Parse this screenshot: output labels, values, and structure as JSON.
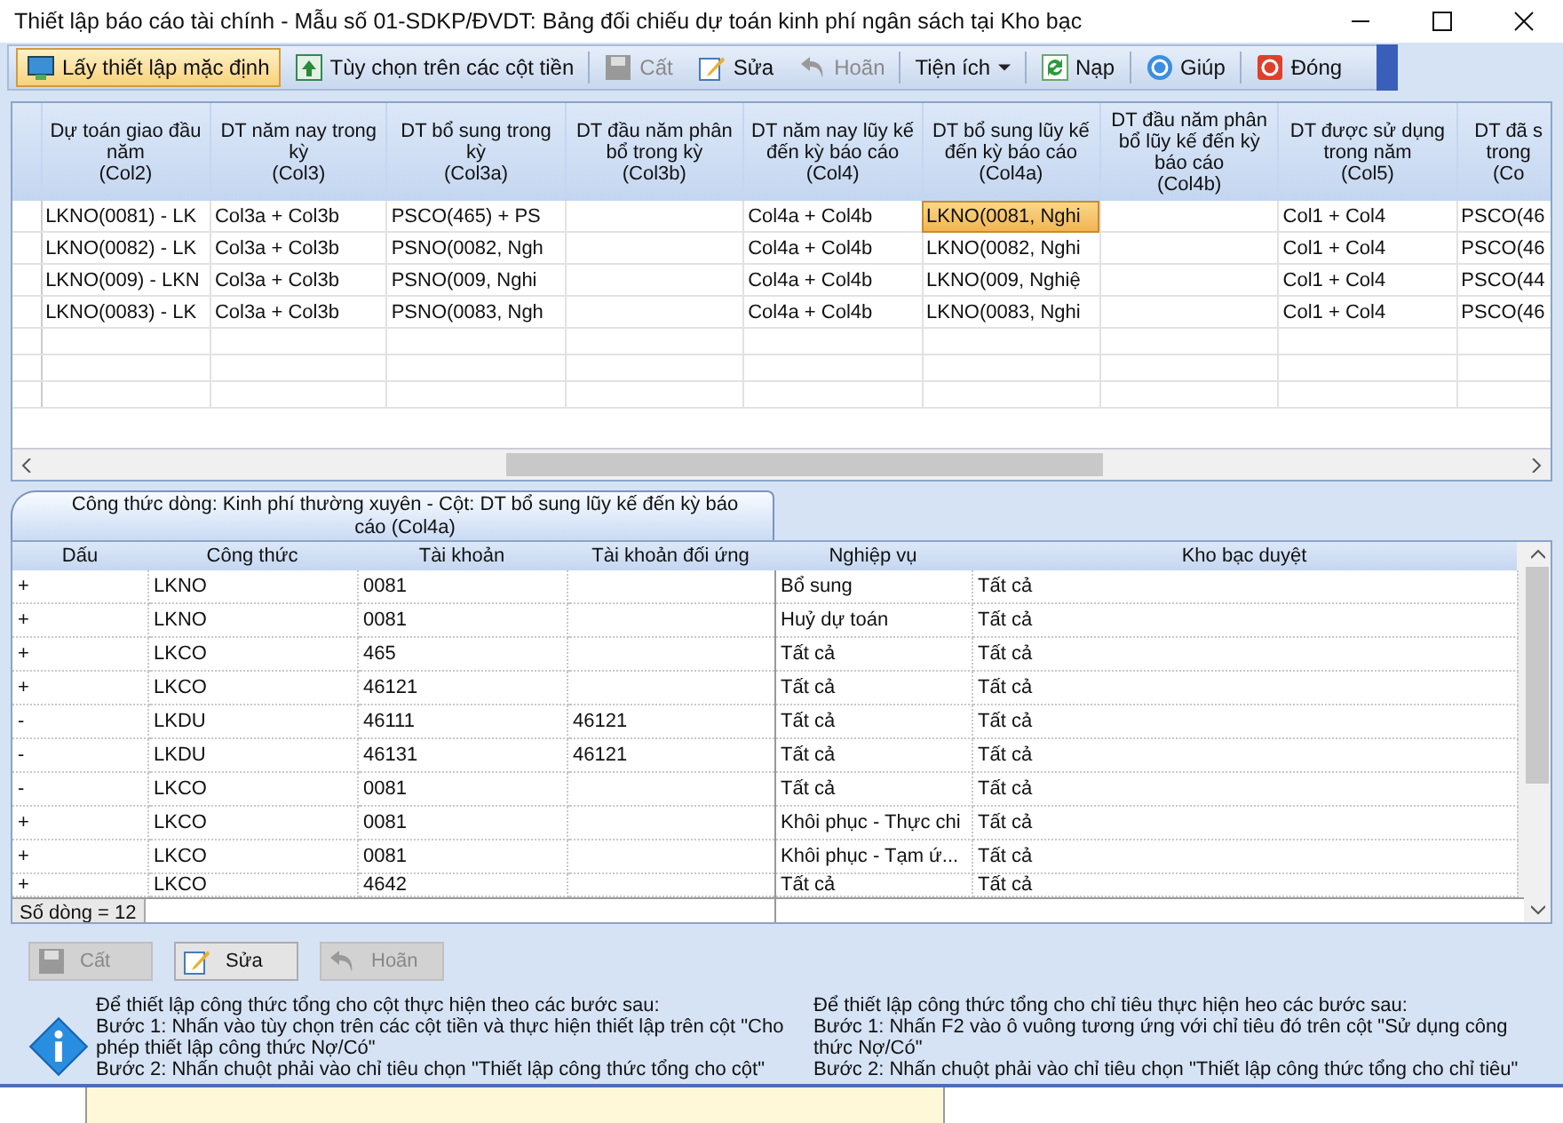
{
  "window": {
    "title": "Thiết lập báo cáo tài chính - Mẫu số 01-SDKP/ĐVDT: Bảng đối chiếu dự toán kinh phí ngân sách tại Kho bạc"
  },
  "toolbar": [
    {
      "kind": "default",
      "label": "Lấy thiết lập mặc định",
      "disabled": false
    },
    {
      "kind": "options",
      "label": "Tùy chọn trên các cột tiền",
      "disabled": false
    },
    {
      "kind": "save",
      "label": "Cất",
      "disabled": true
    },
    {
      "kind": "edit",
      "label": "Sửa",
      "disabled": false
    },
    {
      "kind": "undo",
      "label": "Hoãn",
      "disabled": true
    },
    {
      "kind": "menu",
      "label": "Tiện ích",
      "disabled": false
    },
    {
      "kind": "reload",
      "label": "Nạp",
      "disabled": false
    },
    {
      "kind": "help",
      "label": "Giúp",
      "disabled": false
    },
    {
      "kind": "close",
      "label": "Đóng",
      "disabled": false
    }
  ],
  "top_table": {
    "columns": [
      "Dự toán giao đầu\nnăm\n(Col2)",
      "DT năm nay trong\nkỳ\n(Col3)",
      "DT bổ sung trong\nkỳ\n(Col3a)",
      "DT đầu năm phân\nbổ trong kỳ\n(Col3b)",
      "DT năm nay lũy kế\nđến kỳ báo cáo\n(Col4)",
      "DT bổ sung lũy kế\nđến kỳ báo cáo\n(Col4a)",
      "DT đầu năm phân\nbổ lũy kế đến kỳ\nbáo cáo\n(Col4b)",
      "DT được sử dụng\ntrong năm\n(Col5)",
      "DT đã s\ntrong\n(Co"
    ],
    "rows": [
      {
        "cells": [
          {
            "text": "LKNO(0081) - LK",
            "selected": false
          },
          {
            "text": "Col3a + Col3b",
            "selected": false
          },
          {
            "text": "PSCO(465) + PS",
            "selected": false
          },
          {
            "selected": false
          },
          {
            "text": "Col4a + Col4b",
            "selected": false
          },
          {
            "text": "LKNO(0081, Nghi",
            "selected": true
          },
          {
            "selected": false
          },
          {
            "text": "Col1 + Col4",
            "selected": false
          },
          {
            "text": "PSCO(46",
            "selected": false
          }
        ]
      },
      {
        "cells": [
          {
            "text": "LKNO(0082) - LK",
            "selected": false
          },
          {
            "text": "Col3a + Col3b",
            "selected": false
          },
          {
            "text": "PSNO(0082, Ngh",
            "selected": false
          },
          {
            "selected": false
          },
          {
            "text": "Col4a + Col4b",
            "selected": false
          },
          {
            "text": "LKNO(0082, Nghi",
            "selected": false
          },
          {
            "selected": false
          },
          {
            "text": "Col1 + Col4",
            "selected": false
          },
          {
            "text": "PSCO(46",
            "selected": false
          }
        ]
      },
      {
        "cells": [
          {
            "text": "LKNO(009) - LKN",
            "selected": false
          },
          {
            "text": "Col3a + Col3b",
            "selected": false
          },
          {
            "text": "PSNO(009, Nghi",
            "selected": false
          },
          {
            "selected": false
          },
          {
            "text": "Col4a + Col4b",
            "selected": false
          },
          {
            "text": "LKNO(009, Nghiệ",
            "selected": false
          },
          {
            "selected": false
          },
          {
            "text": "Col1 + Col4",
            "selected": false
          },
          {
            "text": "PSCO(44",
            "selected": false
          }
        ]
      },
      {
        "cells": [
          {
            "text": "LKNO(0083) - LK",
            "selected": false
          },
          {
            "text": "Col3a + Col3b",
            "selected": false
          },
          {
            "text": "PSNO(0083, Ngh",
            "selected": false
          },
          {
            "selected": false
          },
          {
            "text": "Col4a + Col4b",
            "selected": false
          },
          {
            "text": "LKNO(0083, Nghi",
            "selected": false
          },
          {
            "selected": false
          },
          {
            "text": "Col1 + Col4",
            "selected": false
          },
          {
            "text": "PSCO(46",
            "selected": false
          }
        ]
      }
    ]
  },
  "tab": {
    "label": "Công thức dòng: Kinh phí thường xuyên - Cột: DT bổ sung lũy kế đến kỳ báo cáo (Col4a)",
    "selected": true
  },
  "formula_table": {
    "columns": [
      "Dấu",
      "Công thức",
      "Tài khoản",
      "Tài khoản đối ứng",
      "Nghiệp vụ",
      "Kho bạc duyệt"
    ],
    "rows": [
      [
        "+",
        "LKNO",
        "0081",
        "",
        "Bổ sung",
        "Tất cả"
      ],
      [
        "+",
        "LKNO",
        "0081",
        "",
        "Huỷ dự toán",
        "Tất cả"
      ],
      [
        "+",
        "LKCO",
        "465",
        "",
        "Tất cả",
        "Tất cả"
      ],
      [
        "+",
        "LKCO",
        "46121",
        "",
        "Tất cả",
        "Tất cả"
      ],
      [
        "-",
        "LKDU",
        "46111",
        "46121",
        "Tất cả",
        "Tất cả"
      ],
      [
        "-",
        "LKDU",
        "46131",
        "46121",
        "Tất cả",
        "Tất cả"
      ],
      [
        "-",
        "LKCO",
        "0081",
        "",
        "Tất cả",
        "Tất cả"
      ],
      [
        "+",
        "LKCO",
        "0081",
        "",
        "Khôi phục - Thực chi",
        "Tất cả"
      ],
      [
        "+",
        "LKCO",
        "0081",
        "",
        "Khôi phục - Tạm ứ...",
        "Tất cả"
      ],
      [
        "+",
        "LKCO",
        "4642",
        "",
        "Tất cả",
        "Tất cả"
      ]
    ],
    "footer": "Số dòng = 12"
  },
  "actions": [
    {
      "kind": "save",
      "label": "Cất",
      "disabled": true
    },
    {
      "kind": "edit",
      "label": "Sửa",
      "disabled": false
    },
    {
      "kind": "undo",
      "label": "Hoãn",
      "disabled": true
    }
  ],
  "help": [
    [
      "Để thiết lập công thức tổng cho cột thực hiện theo các bước sau:",
      "Bước 1: Nhấn vào tùy chọn trên các cột tiền và thực hiện thiết lập trên cột \"Cho phép thiết lập công thức Nợ/Có\"",
      "Bước 2: Nhấn chuột phải vào chỉ tiêu chọn \"Thiết lập công thức tổng cho cột\""
    ],
    [
      "Để thiết lập công thức tổng cho chỉ tiêu thực hiện heo các bước sau:",
      "Bước 1: Nhấn F2 vào ô vuông tương ứng với chỉ tiêu đó trên cột  \"Sử dụng công thức Nợ/Có\"",
      "Bước 2: Nhấn chuột phải vào chỉ tiêu chọn \"Thiết lập công thức tổng cho chỉ tiêu\""
    ]
  ]
}
